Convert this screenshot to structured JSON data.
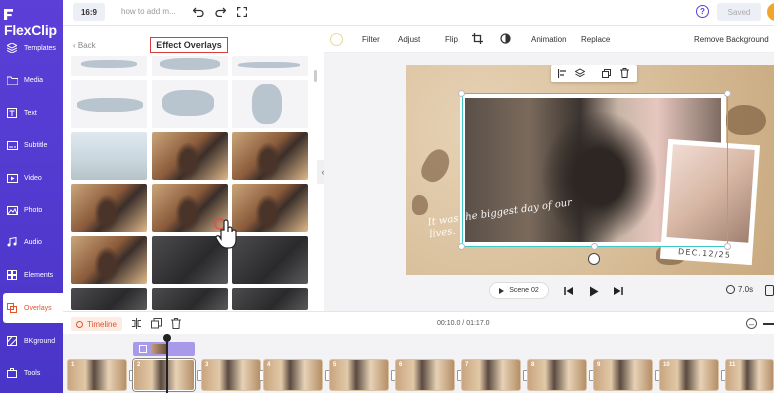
{
  "app": {
    "logo_text": "FlexClip"
  },
  "topbar": {
    "ratio": "16:9",
    "project_name": "how to add m...",
    "saved_label": "Saved"
  },
  "sidebar": {
    "items": [
      {
        "label": "Templates",
        "icon": "templates-icon"
      },
      {
        "label": "Media",
        "icon": "folder-icon"
      },
      {
        "label": "Text",
        "icon": "text-icon"
      },
      {
        "label": "Subtitle",
        "icon": "subtitle-icon"
      },
      {
        "label": "Video",
        "icon": "video-icon"
      },
      {
        "label": "Photo",
        "icon": "photo-icon"
      },
      {
        "label": "Audio",
        "icon": "audio-icon"
      },
      {
        "label": "Elements",
        "icon": "elements-icon"
      },
      {
        "label": "Overlays",
        "icon": "overlays-icon",
        "active": true
      },
      {
        "label": "BKground",
        "icon": "background-icon"
      },
      {
        "label": "Tools",
        "icon": "tools-icon"
      }
    ]
  },
  "panel": {
    "back_label": "Back",
    "title": "Effect Overlays"
  },
  "editor_toolbar": {
    "tools": [
      "Filter",
      "Adjust",
      "Flip",
      "Animation",
      "Replace",
      "Remove Background"
    ]
  },
  "canvas": {
    "script_text": "It was the biggest day of our lives.",
    "date_text": "DEC.12/25"
  },
  "playback": {
    "scene_label": "Scene 02",
    "duration": "7.0s"
  },
  "timeline": {
    "label": "Timeline",
    "time_readout": "00:10.0 / 01:17.0",
    "scenes": [
      "1",
      "2",
      "3",
      "4",
      "5",
      "6",
      "7",
      "8",
      "9",
      "10",
      "11"
    ]
  },
  "colors": {
    "sidebar": "#4a35c9",
    "accent": "#e0552a",
    "selection": "#3fc8c8",
    "title_outline": "#d93a3a"
  }
}
